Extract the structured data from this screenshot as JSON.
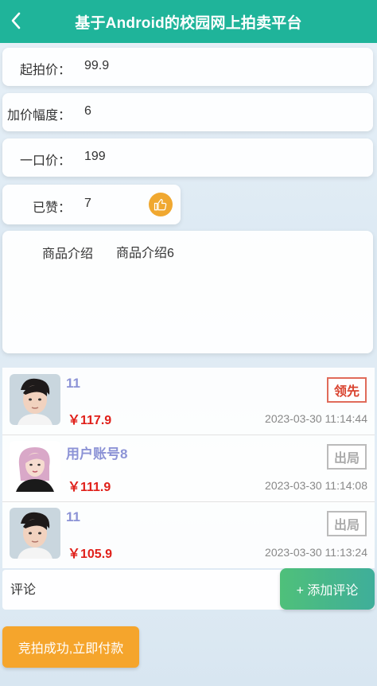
{
  "header": {
    "title": "基于Android的校园网上拍卖平台",
    "back_icon": "chevron-left-icon"
  },
  "fields": {
    "start_price": {
      "label": "起拍价：",
      "value": "99.9"
    },
    "increment": {
      "label": "加价幅度：",
      "value": "6"
    },
    "buy_now": {
      "label": "一口价：",
      "value": "199"
    },
    "likes": {
      "label": "已赞：",
      "value": "7",
      "icon": "thumbs-up-icon"
    },
    "description": {
      "label": "商品介绍",
      "value": "商品介绍6"
    }
  },
  "bids": [
    {
      "user": "11",
      "price": "￥117.9",
      "time": "2023-03-30 11:14:44",
      "status": "领先"
    },
    {
      "user": "用户账号8",
      "price": "￥111.9",
      "time": "2023-03-30 11:14:08",
      "status": "出局"
    },
    {
      "user": "11",
      "price": "￥105.9",
      "time": "2023-03-30 11:13:24",
      "status": "出局"
    }
  ],
  "comment": {
    "placeholder": "评论",
    "add_label": "+ 添加评论"
  },
  "pay_button": "竞拍成功,立即付款",
  "colors": {
    "header": "#1fb49a",
    "price": "#e0201a",
    "lead": "#d9432f",
    "pay": "#f5a52c",
    "like": "#f0a830"
  }
}
